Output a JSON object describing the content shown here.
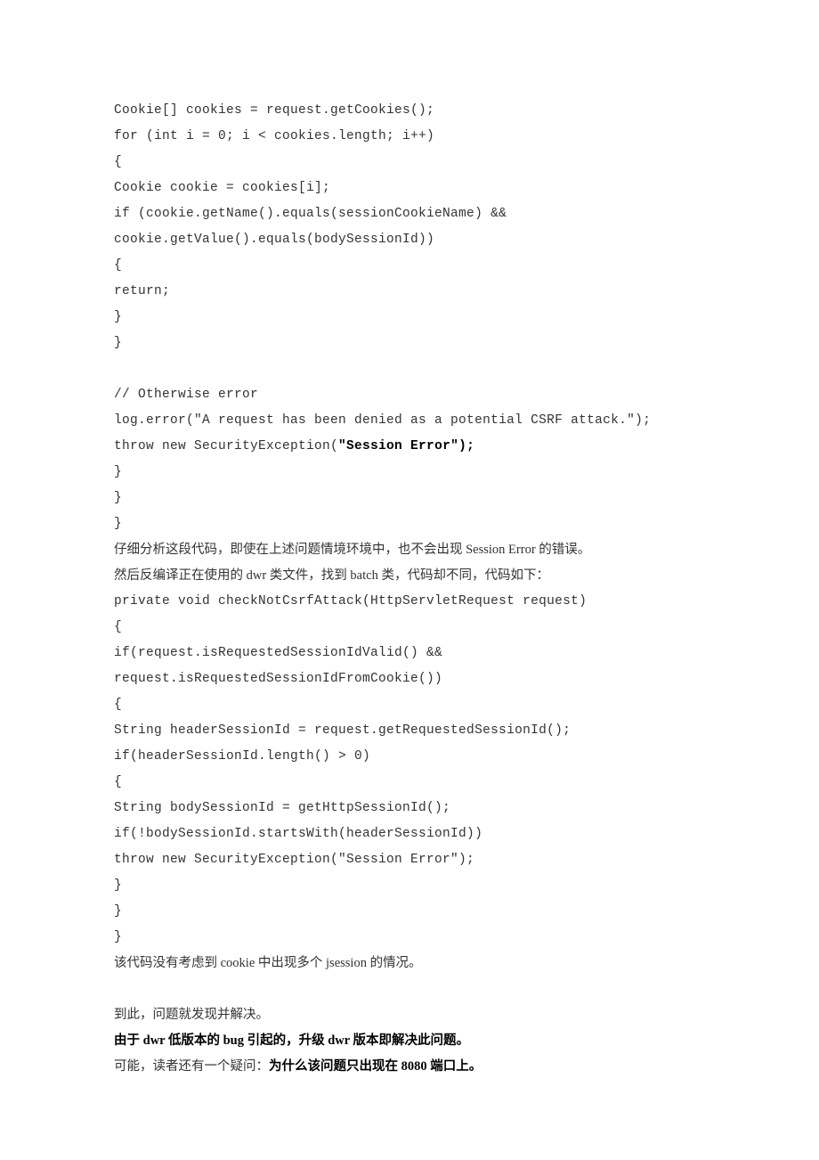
{
  "lines": [
    {
      "text": "Cookie[] cookies = request.getCookies();",
      "class": "code"
    },
    {
      "text": "for (int i = 0; i < cookies.length; i++)",
      "class": "code"
    },
    {
      "text": "{",
      "class": "code"
    },
    {
      "text": "Cookie cookie = cookies[i];",
      "class": "code"
    },
    {
      "text": "if (cookie.getName().equals(sessionCookieName) && cookie.getValue().equals(bodySessionId))",
      "class": "code"
    },
    {
      "text": "{",
      "class": "code"
    },
    {
      "text": "return;",
      "class": "code"
    },
    {
      "text": "}",
      "class": "code"
    },
    {
      "text": "}",
      "class": "code"
    },
    {
      "text": "",
      "class": "code"
    },
    {
      "text": "// Otherwise error",
      "class": "code"
    },
    {
      "text": "log.error(\"A request has been denied as a potential CSRF attack.\");",
      "class": "code"
    },
    {
      "parts": [
        {
          "text": "throw new SecurityException(",
          "class": "code"
        },
        {
          "text": "\"Session Error\");",
          "class": "code bold"
        }
      ]
    },
    {
      "text": "}",
      "class": "code"
    },
    {
      "text": "}",
      "class": "code"
    },
    {
      "text": "}",
      "class": "code"
    },
    {
      "text": "仔细分析这段代码，即使在上述问题情境环境中，也不会出现 Session Error 的错误。",
      "class": "cn"
    },
    {
      "text": "然后反编译正在使用的 dwr 类文件，找到 batch 类，代码却不同，代码如下：",
      "class": "cn"
    },
    {
      "text": "private void checkNotCsrfAttack(HttpServletRequest request)",
      "class": "code"
    },
    {
      "text": "{",
      "class": "code"
    },
    {
      "text": "if(request.isRequestedSessionIdValid() && request.isRequestedSessionIdFromCookie())",
      "class": "code"
    },
    {
      "text": "{",
      "class": "code"
    },
    {
      "text": "String headerSessionId = request.getRequestedSessionId();",
      "class": "code"
    },
    {
      "text": "if(headerSessionId.length() > 0)",
      "class": "code"
    },
    {
      "text": "{",
      "class": "code"
    },
    {
      "text": "String bodySessionId = getHttpSessionId();",
      "class": "code"
    },
    {
      "text": "if(!bodySessionId.startsWith(headerSessionId))",
      "class": "code"
    },
    {
      "text": "throw new SecurityException(\"Session Error\");",
      "class": "code"
    },
    {
      "text": "}",
      "class": "code"
    },
    {
      "text": "}",
      "class": "code"
    },
    {
      "text": "}",
      "class": "code"
    },
    {
      "text": "该代码没有考虑到 cookie 中出现多个 jsession 的情况。",
      "class": "cn"
    },
    {
      "text": "",
      "class": "cn"
    },
    {
      "text": "到此，问题就发现并解决。",
      "class": "cn"
    },
    {
      "text": "由于 dwr 低版本的 bug 引起的，升级 dwr 版本即解决此问题。",
      "class": "cn bold"
    },
    {
      "parts": [
        {
          "text": "可能，读者还有一个疑问：",
          "class": "cn"
        },
        {
          "text": "为什么该问题只出现在 8080 端口上。",
          "class": "cn bold"
        }
      ]
    }
  ]
}
